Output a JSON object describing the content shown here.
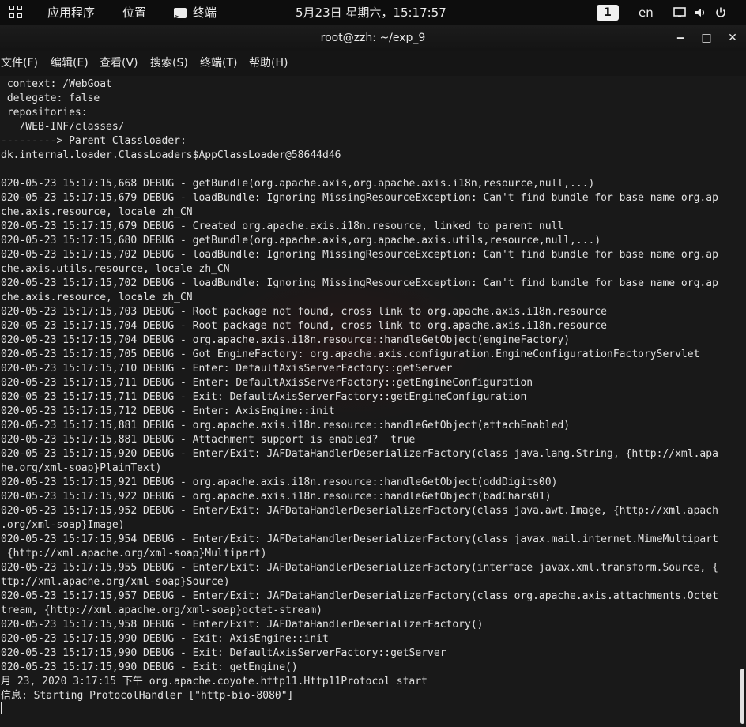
{
  "topbar": {
    "apps_label": "应用程序",
    "places_label": "位置",
    "terminal_label": "终端",
    "clock": "5月23日 星期六，15:17:57",
    "workspace": "1",
    "keyboard_layout": "en"
  },
  "window": {
    "title": "root@zzh: ~/exp_9",
    "minimize_glyph": "‒",
    "maximize_glyph": "□",
    "close_glyph": "✕"
  },
  "menu": {
    "items": [
      {
        "label": "文件(F)"
      },
      {
        "label": "编辑(E)"
      },
      {
        "label": "查看(V)"
      },
      {
        "label": "搜索(S)"
      },
      {
        "label": "终端(T)"
      },
      {
        "label": "帮助(H)"
      }
    ]
  },
  "terminal": {
    "lines": [
      " context: /WebGoat",
      " delegate: false",
      " repositories:",
      "   /WEB-INF/classes/",
      "---------> Parent Classloader:",
      "dk.internal.loader.ClassLoaders$AppClassLoader@58644d46",
      "",
      "020-05-23 15:17:15,668 DEBUG - getBundle(org.apache.axis,org.apache.axis.i18n,resource,null,...)",
      "020-05-23 15:17:15,679 DEBUG - loadBundle: Ignoring MissingResourceException: Can't find bundle for base name org.ap",
      "che.axis.resource, locale zh_CN",
      "020-05-23 15:17:15,679 DEBUG - Created org.apache.axis.i18n.resource, linked to parent null",
      "020-05-23 15:17:15,680 DEBUG - getBundle(org.apache.axis,org.apache.axis.utils,resource,null,...)",
      "020-05-23 15:17:15,702 DEBUG - loadBundle: Ignoring MissingResourceException: Can't find bundle for base name org.ap",
      "che.axis.utils.resource, locale zh_CN",
      "020-05-23 15:17:15,702 DEBUG - loadBundle: Ignoring MissingResourceException: Can't find bundle for base name org.ap",
      "che.axis.resource, locale zh_CN",
      "020-05-23 15:17:15,703 DEBUG - Root package not found, cross link to org.apache.axis.i18n.resource",
      "020-05-23 15:17:15,704 DEBUG - Root package not found, cross link to org.apache.axis.i18n.resource",
      "020-05-23 15:17:15,704 DEBUG - org.apache.axis.i18n.resource::handleGetObject(engineFactory)",
      "020-05-23 15:17:15,705 DEBUG - Got EngineFactory: org.apache.axis.configuration.EngineConfigurationFactoryServlet",
      "020-05-23 15:17:15,710 DEBUG - Enter: DefaultAxisServerFactory::getServer",
      "020-05-23 15:17:15,711 DEBUG - Enter: DefaultAxisServerFactory::getEngineConfiguration",
      "020-05-23 15:17:15,711 DEBUG - Exit: DefaultAxisServerFactory::getEngineConfiguration",
      "020-05-23 15:17:15,712 DEBUG - Enter: AxisEngine::init",
      "020-05-23 15:17:15,881 DEBUG - org.apache.axis.i18n.resource::handleGetObject(attachEnabled)",
      "020-05-23 15:17:15,881 DEBUG - Attachment support is enabled?  true",
      "020-05-23 15:17:15,920 DEBUG - Enter/Exit: JAFDataHandlerDeserializerFactory(class java.lang.String, {http://xml.apa",
      "he.org/xml-soap}PlainText)",
      "020-05-23 15:17:15,921 DEBUG - org.apache.axis.i18n.resource::handleGetObject(oddDigits00)",
      "020-05-23 15:17:15,922 DEBUG - org.apache.axis.i18n.resource::handleGetObject(badChars01)",
      "020-05-23 15:17:15,952 DEBUG - Enter/Exit: JAFDataHandlerDeserializerFactory(class java.awt.Image, {http://xml.apach",
      ".org/xml-soap}Image)",
      "020-05-23 15:17:15,954 DEBUG - Enter/Exit: JAFDataHandlerDeserializerFactory(class javax.mail.internet.MimeMultipart",
      " {http://xml.apache.org/xml-soap}Multipart)",
      "020-05-23 15:17:15,955 DEBUG - Enter/Exit: JAFDataHandlerDeserializerFactory(interface javax.xml.transform.Source, {",
      "ttp://xml.apache.org/xml-soap}Source)",
      "020-05-23 15:17:15,957 DEBUG - Enter/Exit: JAFDataHandlerDeserializerFactory(class org.apache.axis.attachments.Octet",
      "tream, {http://xml.apache.org/xml-soap}octet-stream)",
      "020-05-23 15:17:15,958 DEBUG - Enter/Exit: JAFDataHandlerDeserializerFactory()",
      "020-05-23 15:17:15,990 DEBUG - Exit: AxisEngine::init",
      "020-05-23 15:17:15,990 DEBUG - Exit: DefaultAxisServerFactory::getServer",
      "020-05-23 15:17:15,990 DEBUG - Exit: getEngine()",
      "月 23, 2020 3:17:15 下午 org.apache.coyote.http11.Http11Protocol start",
      "信息: Starting ProtocolHandler [\"http-bio-8080\"]"
    ]
  },
  "colors": {
    "topbar_bg": "#0d0d0d",
    "terminal_bg": "#191919",
    "terminal_fg": "#e2e2e2"
  }
}
